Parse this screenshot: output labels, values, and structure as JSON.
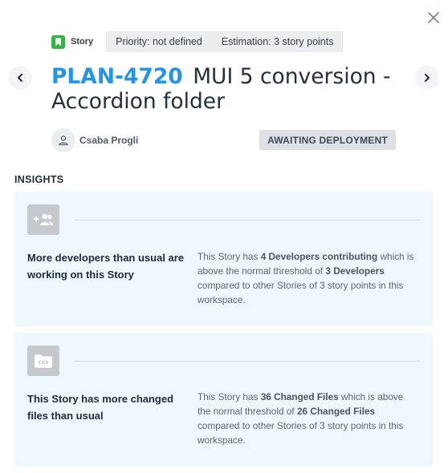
{
  "header": {
    "issue_type": "Story",
    "priority": "Priority: not defined",
    "estimation": "Estimation: 3 story points",
    "issue_key": "PLAN-4720",
    "issue_title": "MUI 5 conversion - Accordion folder",
    "assignee": "Csaba Progli",
    "status": "AWAITING DEPLOYMENT"
  },
  "insights": {
    "section_title": "INSIGHTS",
    "cards": [
      {
        "icon": "group-add-icon",
        "heading": "More developers than usual are working on this Story",
        "text_1": "This Story has ",
        "highlight_1": "4 Developers contributing",
        "text_2": " which is above the normal threshold of ",
        "highlight_2": "3 Developers",
        "text_3": " compared to other Stories of 3 story points in this workspace."
      },
      {
        "icon": "folder-code-icon",
        "heading": "This Story has more changed files than usual",
        "text_1": "This Story has ",
        "highlight_1": "36 Changed Files",
        "text_2": " which is above the normal threshold of ",
        "highlight_2": "26 Changed Files",
        "text_3": " compared to other Stories of 3 story points in this workspace."
      }
    ]
  },
  "colors": {
    "accent": "#2394e6",
    "story_green": "#33b545",
    "card_bg": "#eef7fb",
    "status_bg": "#dde1e5"
  }
}
